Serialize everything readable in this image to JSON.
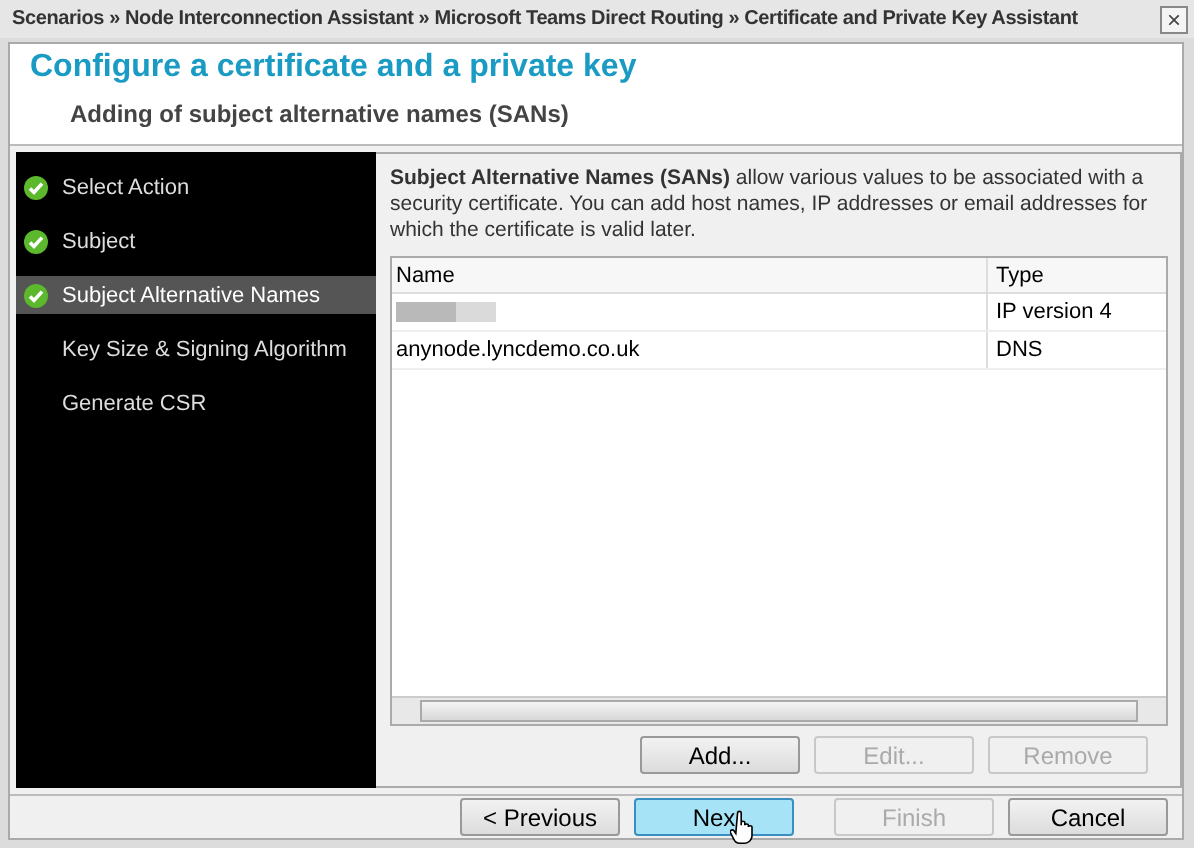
{
  "window": {
    "title": "Scenarios » Node Interconnection Assistant » Microsoft Teams Direct Routing » Certificate and Private Key Assistant",
    "close": "×"
  },
  "header": {
    "title": "Configure a certificate and a private key",
    "subtitle": "Adding of subject alternative names (SANs)"
  },
  "steps": [
    {
      "label": "Select Action",
      "done": true,
      "selected": false
    },
    {
      "label": "Subject",
      "done": true,
      "selected": false
    },
    {
      "label": "Subject Alternative Names",
      "done": true,
      "selected": true
    },
    {
      "label": "Key Size & Signing Algorithm",
      "done": false,
      "selected": false
    },
    {
      "label": "Generate CSR",
      "done": false,
      "selected": false
    }
  ],
  "description": "**Subject Alternative Names (SANs)** allow various values to be associated with a security certificate. You can add host names, IP addresses or email addresses for which the certificate is valid later.",
  "table": {
    "columns": [
      "Name",
      "Type"
    ],
    "rows": [
      {
        "name": "",
        "redacted": true,
        "type": "IP version 4"
      },
      {
        "name": "anynode.lyncdemo.co.uk",
        "redacted": false,
        "type": "DNS"
      }
    ]
  },
  "list_buttons": [
    {
      "label": "Add...",
      "disabled": false
    },
    {
      "label": "Edit...",
      "disabled": true
    },
    {
      "label": "Remove",
      "disabled": true
    }
  ],
  "footer_buttons": [
    {
      "label": "< Previous",
      "disabled": false,
      "default": false
    },
    {
      "label": "Nex",
      "disabled": false,
      "default": true
    },
    {
      "label": "Finish",
      "disabled": true,
      "default": false
    },
    {
      "label": "Cancel",
      "disabled": false,
      "default": false
    }
  ]
}
